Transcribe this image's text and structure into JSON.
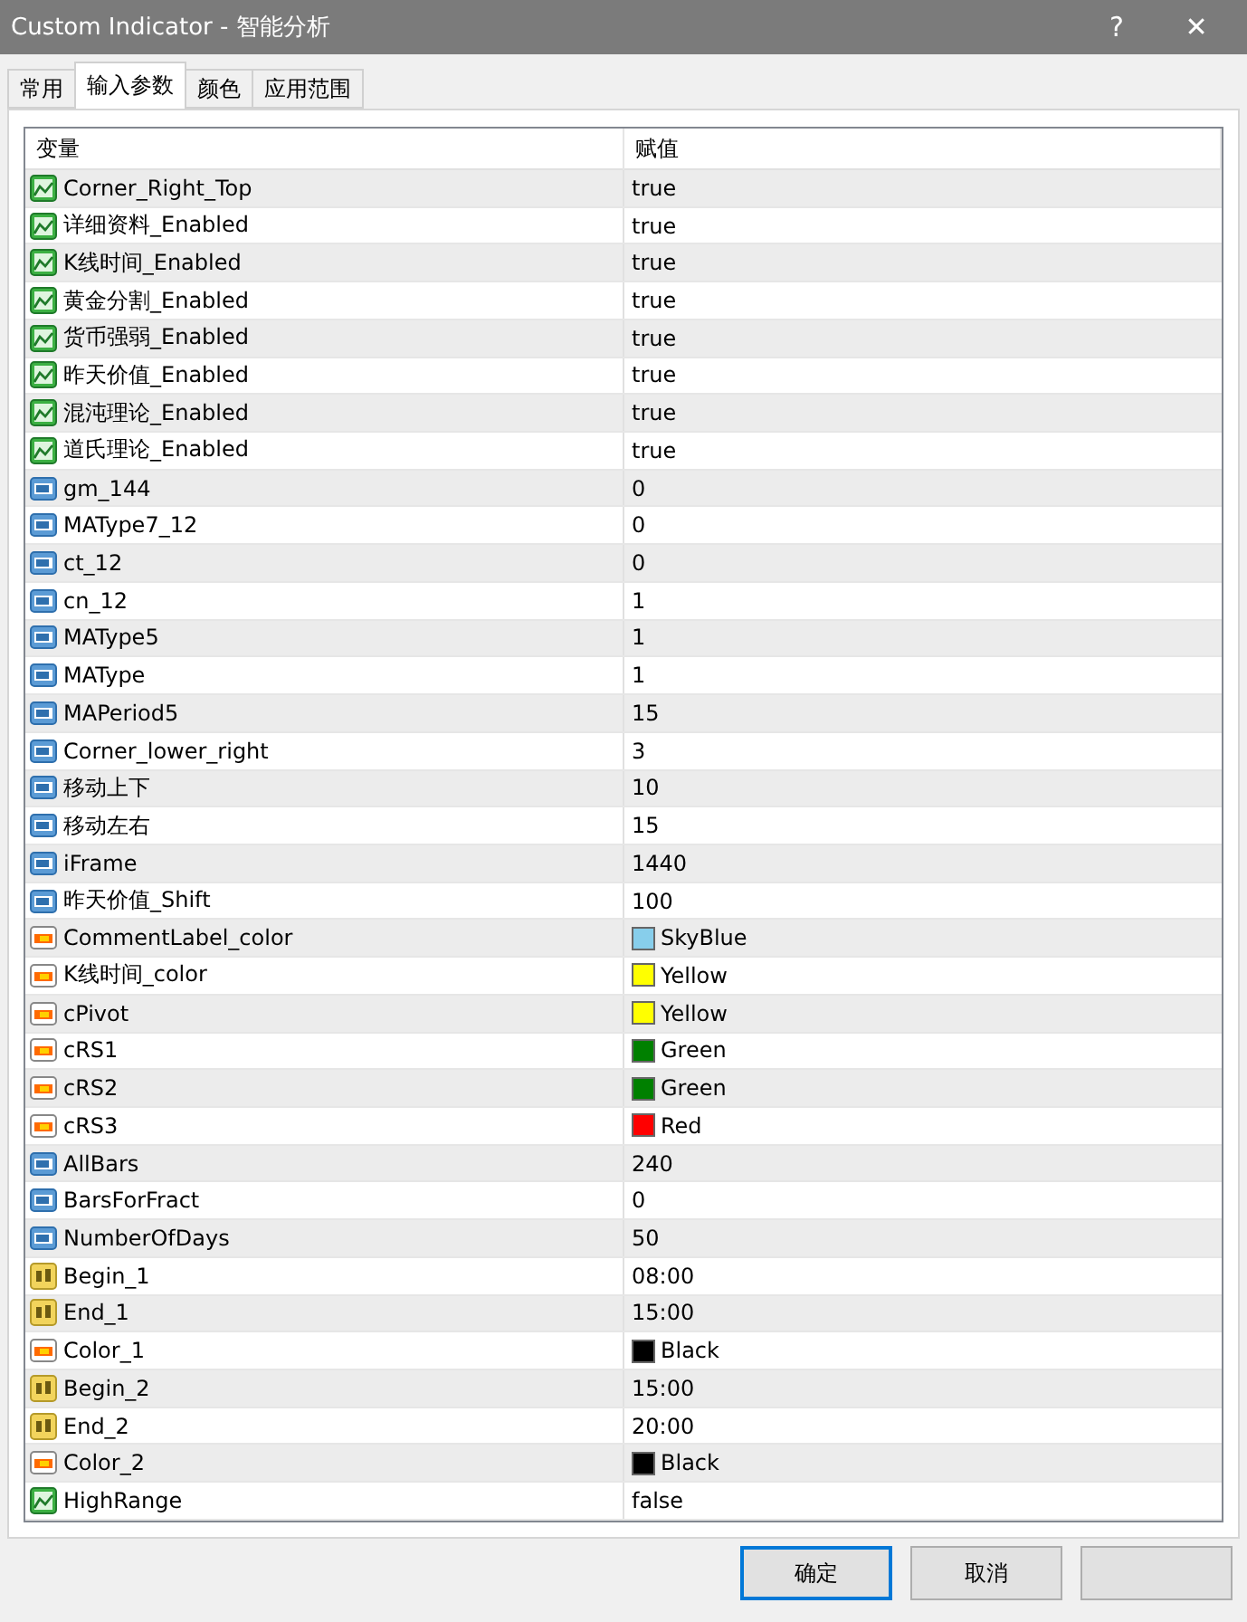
{
  "window": {
    "title": "Custom Indicator - 智能分析",
    "help": "?",
    "close": "✕"
  },
  "tabs": [
    {
      "label": "常用",
      "selected": false
    },
    {
      "label": "输入参数",
      "selected": true
    },
    {
      "label": "颜色",
      "selected": false
    },
    {
      "label": "应用范围",
      "selected": false
    }
  ],
  "table": {
    "columns": [
      "变量",
      "赋值"
    ],
    "rows": [
      {
        "kind": "bool",
        "name": "Corner_Right_Top",
        "value": "true"
      },
      {
        "kind": "bool",
        "name": "详细资料_Enabled",
        "value": "true"
      },
      {
        "kind": "bool",
        "name": "K线时间_Enabled",
        "value": "true"
      },
      {
        "kind": "bool",
        "name": "黄金分割_Enabled",
        "value": "true"
      },
      {
        "kind": "bool",
        "name": "货币强弱_Enabled",
        "value": "true"
      },
      {
        "kind": "bool",
        "name": "昨天价值_Enabled",
        "value": "true"
      },
      {
        "kind": "bool",
        "name": "混沌理论_Enabled",
        "value": "true"
      },
      {
        "kind": "bool",
        "name": "道氏理论_Enabled",
        "value": "true"
      },
      {
        "kind": "int",
        "name": "gm_144",
        "value": "0"
      },
      {
        "kind": "int",
        "name": "MAType7_12",
        "value": "0"
      },
      {
        "kind": "int",
        "name": "ct_12",
        "value": "0"
      },
      {
        "kind": "int",
        "name": "cn_12",
        "value": "1"
      },
      {
        "kind": "int",
        "name": "MAType5",
        "value": "1"
      },
      {
        "kind": "int",
        "name": "MAType",
        "value": "1"
      },
      {
        "kind": "int",
        "name": "MAPeriod5",
        "value": "15"
      },
      {
        "kind": "int",
        "name": "Corner_lower_right",
        "value": "3"
      },
      {
        "kind": "int",
        "name": "移动上下",
        "value": "10"
      },
      {
        "kind": "int",
        "name": "移动左右",
        "value": "15"
      },
      {
        "kind": "int",
        "name": "iFrame",
        "value": "1440"
      },
      {
        "kind": "int",
        "name": "昨天价值_Shift",
        "value": "100"
      },
      {
        "kind": "color",
        "name": "CommentLabel_color",
        "value": "SkyBlue",
        "color": "#87ceeb"
      },
      {
        "kind": "color",
        "name": "K线时间_color",
        "value": "Yellow",
        "color": "#ffff00"
      },
      {
        "kind": "color",
        "name": "cPivot",
        "value": "Yellow",
        "color": "#ffff00"
      },
      {
        "kind": "color",
        "name": "cRS1",
        "value": "Green",
        "color": "#008000"
      },
      {
        "kind": "color",
        "name": "cRS2",
        "value": "Green",
        "color": "#008000"
      },
      {
        "kind": "color",
        "name": "cRS3",
        "value": "Red",
        "color": "#ff0000"
      },
      {
        "kind": "int",
        "name": "AllBars",
        "value": "240"
      },
      {
        "kind": "int",
        "name": "BarsForFract",
        "value": "0"
      },
      {
        "kind": "int",
        "name": "NumberOfDays",
        "value": "50"
      },
      {
        "kind": "string",
        "name": "Begin_1",
        "value": "08:00"
      },
      {
        "kind": "string",
        "name": "End_1",
        "value": "15:00"
      },
      {
        "kind": "color",
        "name": "Color_1",
        "value": "Black",
        "color": "#000000"
      },
      {
        "kind": "string",
        "name": "Begin_2",
        "value": "15:00"
      },
      {
        "kind": "string",
        "name": "End_2",
        "value": "20:00"
      },
      {
        "kind": "color",
        "name": "Color_2",
        "value": "Black",
        "color": "#000000"
      },
      {
        "kind": "bool",
        "name": "HighRange",
        "value": "false"
      }
    ]
  },
  "buttons": [
    {
      "label": "确定",
      "selected": true
    },
    {
      "label": "取消",
      "selected": false
    }
  ]
}
